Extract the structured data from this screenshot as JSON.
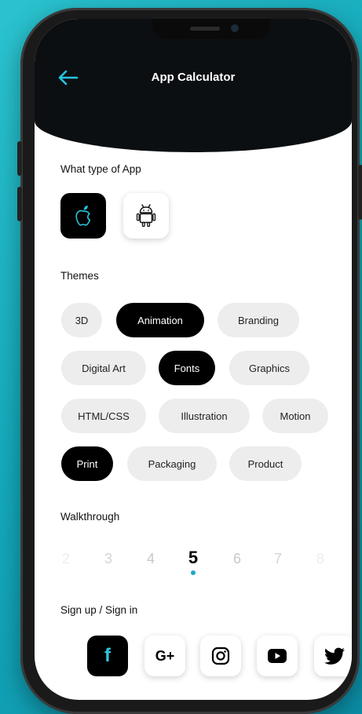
{
  "header": {
    "title": "App Calculator"
  },
  "sections": {
    "app_type_label": "What type of App",
    "themes_label": "Themes",
    "walkthrough_label": "Walkthrough",
    "signup_label": "Sign up / Sign in"
  },
  "app_types": [
    {
      "name": "apple",
      "selected": true
    },
    {
      "name": "android",
      "selected": false
    }
  ],
  "themes": [
    {
      "label": "3D",
      "selected": false
    },
    {
      "label": "Animation",
      "selected": true
    },
    {
      "label": "Branding",
      "selected": false
    },
    {
      "label": "Digital Art",
      "selected": false
    },
    {
      "label": "Fonts",
      "selected": true
    },
    {
      "label": "Graphics",
      "selected": false
    },
    {
      "label": "HTML/CSS",
      "selected": false
    },
    {
      "label": "Illustration",
      "selected": false
    },
    {
      "label": "Motion",
      "selected": false
    },
    {
      "label": "Print",
      "selected": true
    },
    {
      "label": "Packaging",
      "selected": false
    },
    {
      "label": "Product",
      "selected": false
    }
  ],
  "walkthrough": {
    "numbers": [
      "2",
      "3",
      "4",
      "5",
      "6",
      "7",
      "8"
    ],
    "selected": "5"
  },
  "social": [
    {
      "icon": "facebook-icon",
      "glyph": "f",
      "selected": true
    },
    {
      "icon": "google-plus-icon",
      "glyph": "G+",
      "selected": false
    },
    {
      "icon": "instagram-icon",
      "selected": false
    },
    {
      "icon": "youtube-icon",
      "selected": false
    },
    {
      "icon": "twitter-icon",
      "selected": false
    }
  ],
  "colors": {
    "background": "#14a9bb",
    "accent": "#1da8c4",
    "selected": "#000000",
    "chip": "#ededed"
  }
}
